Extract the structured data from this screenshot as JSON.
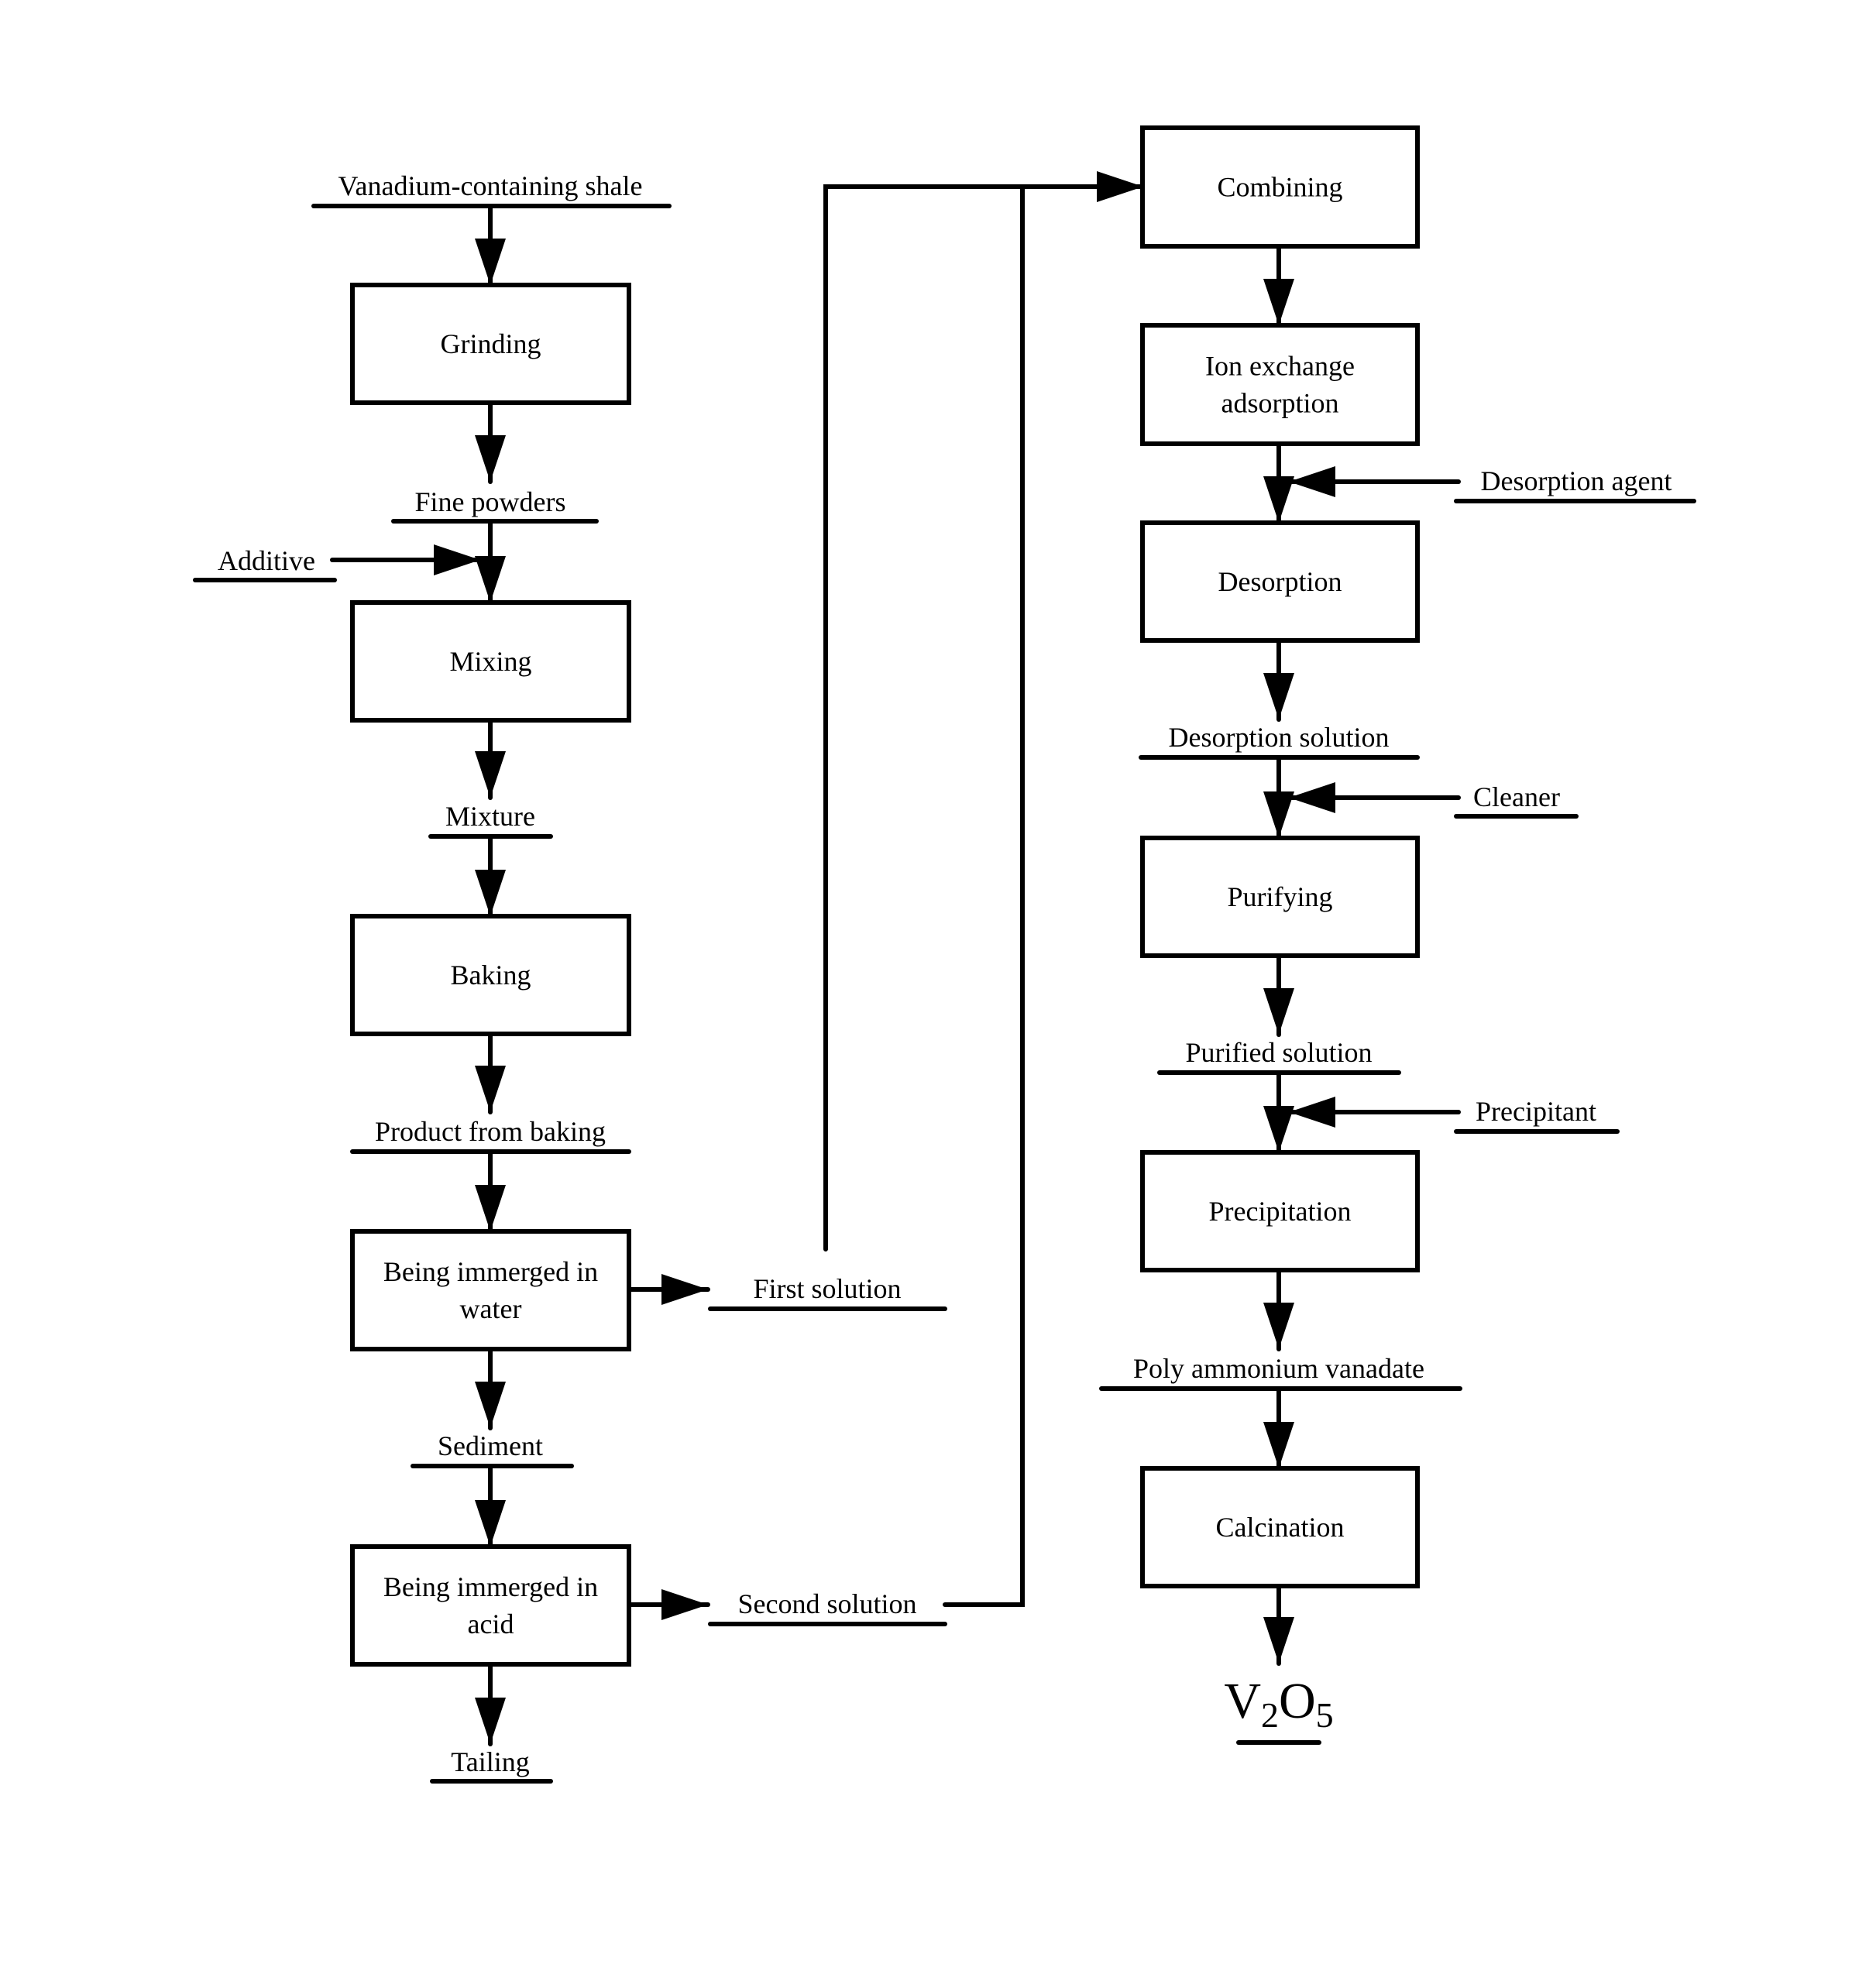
{
  "diagram": {
    "type": "process-flowchart",
    "line_color": "#000000",
    "background": "#ffffff"
  },
  "left_column": {
    "input": "Vanadium-containing shale",
    "steps": [
      {
        "id": "grinding",
        "label": [
          "Grinding"
        ]
      },
      {
        "id": "mixing",
        "label": [
          "Mixing"
        ]
      },
      {
        "id": "baking",
        "label": [
          "Baking"
        ]
      },
      {
        "id": "water-leach",
        "label": [
          "Being immerged in",
          "water"
        ]
      },
      {
        "id": "acid-leach",
        "label": [
          "Being immerged in",
          "acid"
        ]
      }
    ],
    "intermediates": {
      "fine_powders": "Fine powders",
      "additive": "Additive",
      "mixture": "Mixture",
      "product_from_baking": "Product from baking",
      "first_solution": "First solution",
      "sediment": "Sediment",
      "second_solution": "Second solution",
      "tailing": "Tailing"
    }
  },
  "right_column": {
    "steps": [
      {
        "id": "combining",
        "label": [
          "Combining"
        ]
      },
      {
        "id": "ion-exchange",
        "label": [
          "Ion exchange",
          "adsorption"
        ]
      },
      {
        "id": "desorption",
        "label": [
          "Desorption"
        ]
      },
      {
        "id": "purifying",
        "label": [
          "Purifying"
        ]
      },
      {
        "id": "precipitation",
        "label": [
          "Precipitation"
        ]
      },
      {
        "id": "calcination",
        "label": [
          "Calcination"
        ]
      }
    ],
    "intermediates": {
      "desorption_agent": "Desorption agent",
      "desorption_solution": "Desorption solution",
      "cleaner": "Cleaner",
      "purified_solution": "Purified solution",
      "precipitant": "Precipitant",
      "poly_ammonium_vanadate": "Poly ammonium vanadate"
    },
    "product": {
      "parts": [
        {
          "text": "V",
          "sub": false
        },
        {
          "text": "2",
          "sub": true
        },
        {
          "text": "O",
          "sub": false
        },
        {
          "text": "5",
          "sub": true
        }
      ],
      "full": "V2O5"
    }
  }
}
